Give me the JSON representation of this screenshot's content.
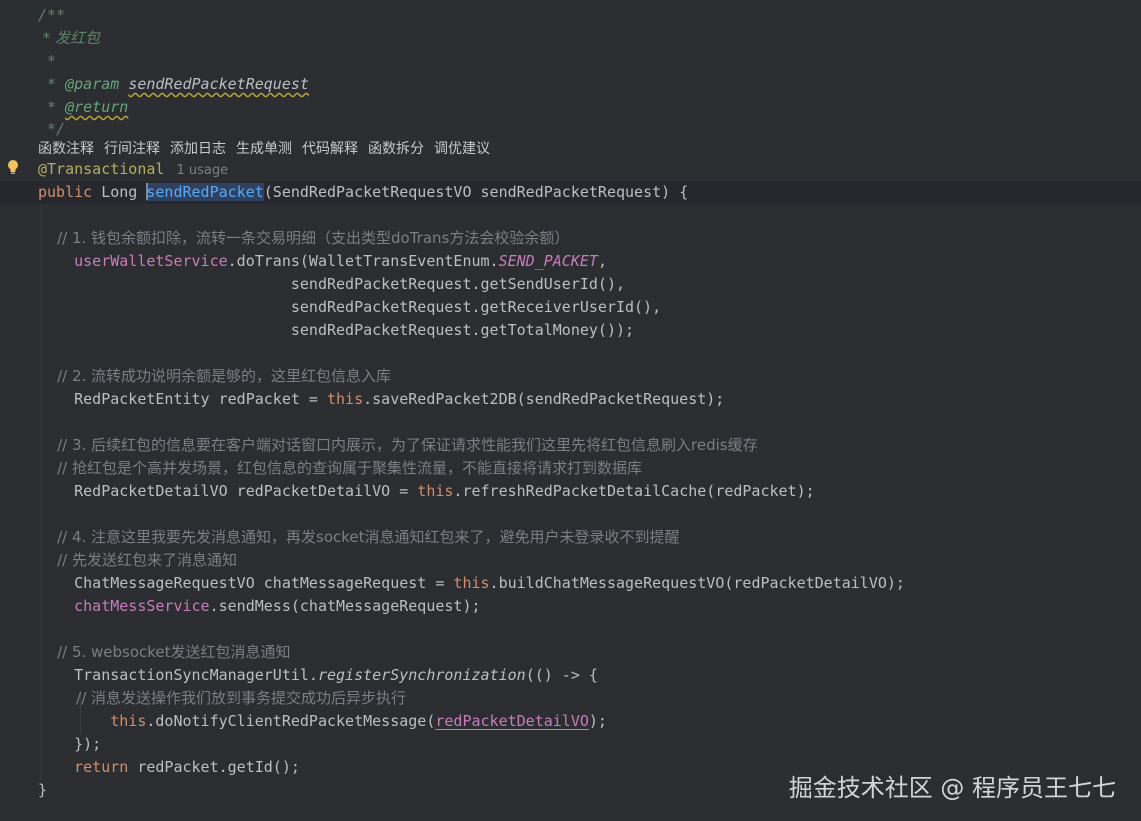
{
  "doc_comment": {
    "open": "/**",
    "title": " * 发红包",
    "blank": " *",
    "param_prefix": " * ",
    "param_tag": "@param",
    "param_name": "sendRedPacketRequest",
    "return_prefix": " * ",
    "return_tag": "@return",
    "close": " */"
  },
  "inlay_actions": [
    "函数注释",
    "行间注释",
    "添加日志",
    "生成单测",
    "代码解释",
    "函数拆分",
    "调优建议"
  ],
  "annotation": "@Transactional",
  "usage_hint": "1 usage",
  "signature": {
    "modifier": "public",
    "return_type": " Long ",
    "method_name": "sendRedPacket",
    "params": "(SendRedPacketRequestVO sendRedPacketRequest) {"
  },
  "code": {
    "c1": "    // 1. 钱包余额扣除，流转一条交易明细（支出类型doTrans方法会校验余额）",
    "l1_field": "userWalletService",
    "l1_rest_a": ".doTrans(WalletTransEventEnum.",
    "l1_const": "SEND_PACKET",
    "l1_rest_b": ",",
    "l2": "                            sendRedPacketRequest.getSendUserId(),",
    "l3": "                            sendRedPacketRequest.getReceiverUserId(),",
    "l4": "                            sendRedPacketRequest.getTotalMoney());",
    "c2": "    // 2. 流转成功说明余额是够的，这里红包信息入库",
    "l5_a": "    RedPacketEntity redPacket = ",
    "kw_this": "this",
    "l5_b": ".saveRedPacket2DB(sendRedPacketRequest);",
    "c3": "    // 3. 后续红包的信息要在客户端对话窗口内展示，为了保证请求性能我们这里先将红包信息刷入redis缓存",
    "c4": "    // 抢红包是个高并发场景，红包信息的查询属于聚集性流量，不能直接将请求打到数据库",
    "l6_a": "    RedPacketDetailVO redPacketDetailVO = ",
    "l6_b": ".refreshRedPacketDetailCache(redPacket);",
    "c5": "    // 4. 注意这里我要先发消息通知，再发socket消息通知红包来了，避免用户未登录收不到提醒",
    "c6": "    // 先发送红包来了消息通知",
    "l7_a": "    ChatMessageRequestVO chatMessageRequest = ",
    "l7_b": ".buildChatMessageRequestVO(redPacketDetailVO);",
    "l8_field": "chatMessService",
    "l8_rest": ".sendMess(chatMessageRequest);",
    "c7": "    // 5. websocket发送红包消息通知",
    "l9_a": "    TransactionSyncManagerUtil.",
    "l9_static": "registerSynchronization",
    "l9_b": "(() -> {",
    "c8": "        // 消息发送操作我们放到事务提交成功后异步执行",
    "l10_a": ".doNotifyClientRedPacketMessage(",
    "l10_u": "redPacketDetailVO",
    "l10_b": ");",
    "l11": "    });",
    "kw_return": "return",
    "l12_b": " redPacket.getId();",
    "close": "}"
  },
  "watermark": "掘金技术社区 @ 程序员王七七",
  "colors": {
    "background": "#2b2d30",
    "keyword": "#cf8e6d",
    "comment": "#7a7e85",
    "doc_comment": "#5f826b",
    "field": "#c77dbb",
    "method_decl": "#56a8f5",
    "annotation": "#b3ae60"
  }
}
